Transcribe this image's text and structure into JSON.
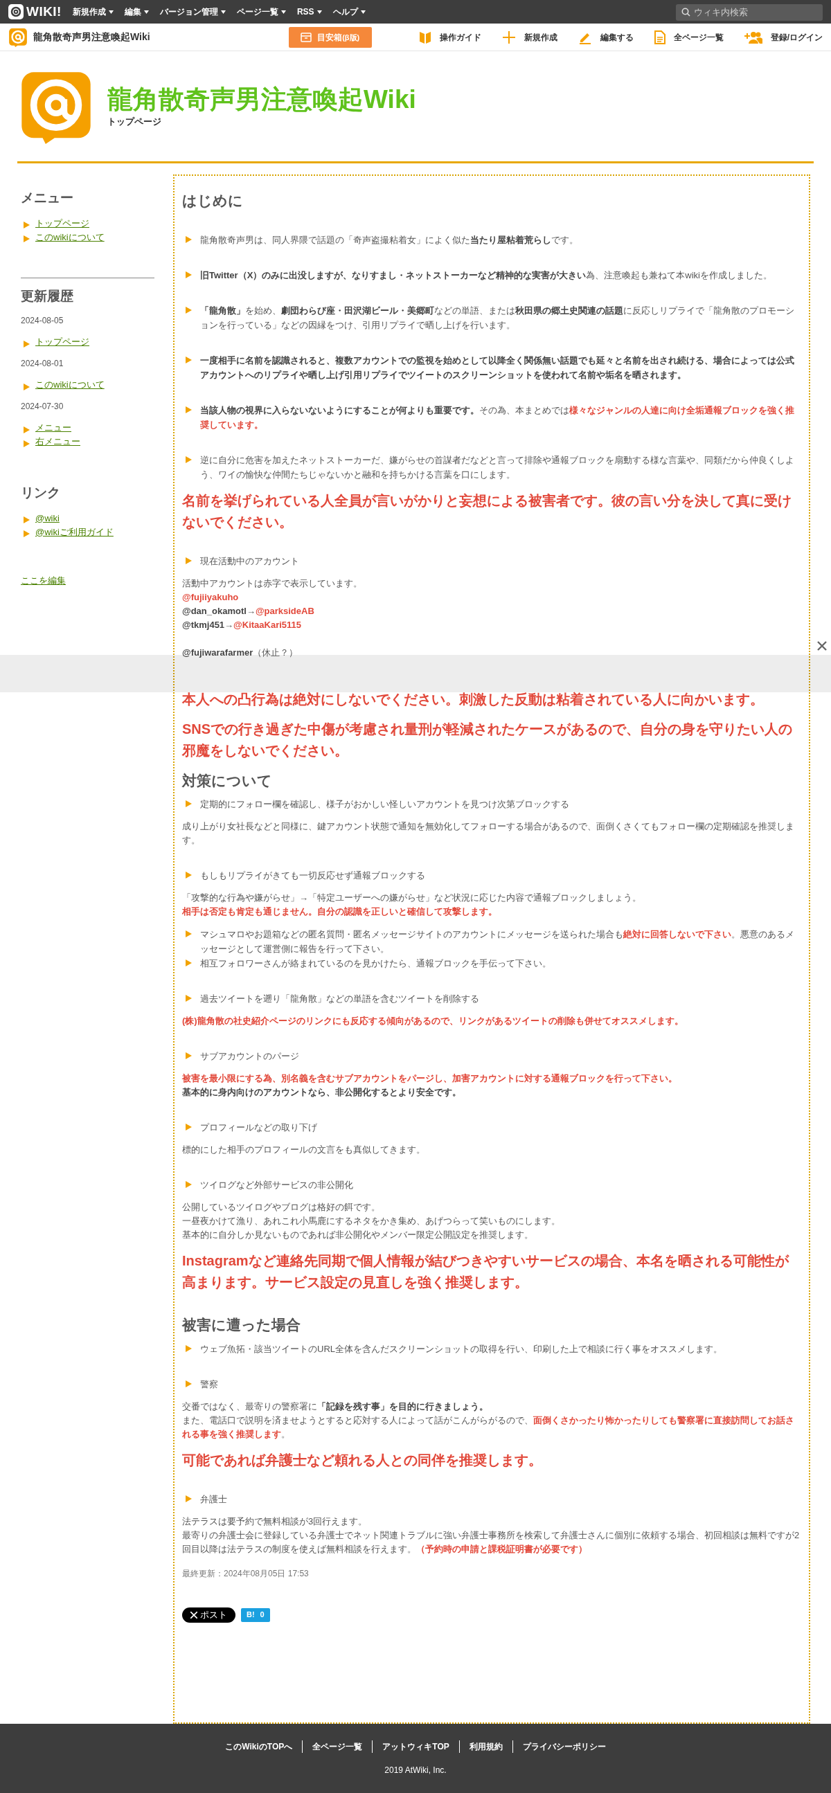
{
  "topbar": {
    "logo": "WIKI!",
    "menus": [
      {
        "label": "新規作成"
      },
      {
        "label": "編集"
      },
      {
        "label": "バージョン管理"
      },
      {
        "label": "ページ一覧"
      },
      {
        "label": "RSS"
      },
      {
        "label": "ヘルプ"
      }
    ],
    "search": {
      "placeholder": "ウィキ内検索"
    }
  },
  "sitebar": {
    "site_name": "龍角散奇声男注意喚起Wiki",
    "box_button": {
      "label": "目安箱",
      "suffix": "(β版)"
    },
    "links": [
      {
        "kind": "guide",
        "label": "操作ガイド"
      },
      {
        "kind": "new",
        "label": "新規作成"
      },
      {
        "kind": "edit",
        "label": "編集する"
      },
      {
        "kind": "pages",
        "label": "全ページ一覧"
      },
      {
        "kind": "login",
        "label": "登録/ログイン"
      }
    ]
  },
  "header": {
    "title": "龍角散奇声男注意喚起Wiki",
    "subtitle": "トップページ"
  },
  "sidebar": {
    "sections": [
      {
        "title": "メニュー",
        "entries": [
          {
            "kind": "link",
            "text": "トップページ"
          },
          {
            "kind": "link",
            "text": "このwikiについて"
          }
        ]
      },
      {
        "title": "更新履歴",
        "entries": [
          {
            "kind": "date",
            "text": "2024-08-05"
          },
          {
            "kind": "link",
            "text": "トップページ"
          },
          {
            "kind": "date",
            "text": "2024-08-01"
          },
          {
            "kind": "link",
            "text": "このwikiについて"
          },
          {
            "kind": "date",
            "text": "2024-07-30"
          },
          {
            "kind": "link",
            "text": "メニュー"
          },
          {
            "kind": "link",
            "text": "右メニュー"
          }
        ]
      },
      {
        "title": "リンク",
        "entries": [
          {
            "kind": "link",
            "text": "@wiki"
          },
          {
            "kind": "link",
            "text": "@wikiご利用ガイド"
          }
        ]
      }
    ],
    "edit_link": "ここを編集"
  },
  "content": {
    "groups": [
      {
        "blocks": [
          {
            "kind": "heading",
            "text": "はじめに"
          }
        ]
      },
      {
        "blocks": [
          {
            "kind": "bullet",
            "parts": [
              {
                "kind": "plain",
                "text": "龍角散奇声男は、同人界隈で話題の「奇声盗撮粘着女」によく似た"
              },
              {
                "kind": "bold",
                "text": "当たり屋粘着荒らし"
              },
              {
                "kind": "plain",
                "text": "です。"
              }
            ]
          }
        ]
      },
      {
        "blocks": [
          {
            "kind": "bullet",
            "parts": [
              {
                "kind": "bold",
                "text": "旧Twitter（X）のみに出没しますが、なりすまし・ネットストーカーなど精神的な実害が大きい"
              },
              {
                "kind": "plain",
                "text": "為、注意喚起も兼ねて本wikiを作成しました。"
              }
            ]
          }
        ]
      },
      {
        "blocks": [
          {
            "kind": "bullet",
            "parts": [
              {
                "kind": "bold",
                "text": "「龍角散」"
              },
              {
                "kind": "plain",
                "text": "を始め、"
              },
              {
                "kind": "bold",
                "text": "劇団わらび座・田沢湖ビール・美郷町"
              },
              {
                "kind": "plain",
                "text": "などの単語、または"
              },
              {
                "kind": "bold",
                "text": "秋田県の郷土史関連の話題"
              },
              {
                "kind": "plain",
                "text": "に反応しリプライで「龍角散のプロモーションを行っている」などの因縁をつけ、引用リプライで晒し上げを行います。"
              }
            ]
          }
        ]
      },
      {
        "blocks": [
          {
            "kind": "bullet",
            "parts": [
              {
                "kind": "bold",
                "text": "一度相手に名前を認識されると、複数アカウントでの監視を始めとして以降全く関係無い話題でも延々と名前を出され続ける、場合によっては公式アカウントへのリプライや晒し上げ引用リプライでツイートのスクリーンショットを使われて名前や垢名を晒されます。"
              }
            ]
          }
        ]
      },
      {
        "blocks": [
          {
            "kind": "bullet",
            "parts": [
              {
                "kind": "bold",
                "text": "当該人物の視界に入らないないようにすることが何よりも重要です。"
              },
              {
                "kind": "plain",
                "text": "その為、本まとめでは"
              },
              {
                "kind": "red",
                "text": "様々なジャンルの人達に向け全垢通報ブロックを強く推奨しています。"
              }
            ]
          }
        ]
      },
      {
        "blocks": [
          {
            "kind": "bullet",
            "parts": [
              {
                "kind": "plain",
                "text": "逆に自分に危害を加えたネットストーカーだ、嫌がらせの首謀者だなどと言って排除や通報ブロックを扇動する様な言葉や、同類だから仲良くしよう、ワイの愉快な仲間たちじゃないかと融和を持ちかける言葉を口にします。"
              }
            ]
          },
          {
            "kind": "alert",
            "text": "名前を挙げられている人全員が言いがかりと妄想による被害者です。彼の言い分を決して真に受けないでください。"
          }
        ]
      },
      {
        "blocks": [
          {
            "kind": "bullet",
            "parts": [
              {
                "kind": "plain",
                "text": "現在活動中のアカウント"
              }
            ]
          },
          {
            "kind": "text",
            "lines": [
              [
                {
                  "kind": "plain",
                  "text": "活動中アカウントは赤字で表示しています。"
                }
              ],
              [
                {
                  "kind": "red",
                  "text": "@fujiiyakuho"
                }
              ],
              [
                {
                  "kind": "bold",
                  "text": "@dan_okamotl"
                },
                {
                  "kind": "plain",
                  "text": "→"
                },
                {
                  "kind": "red",
                  "text": "@parksideAB"
                }
              ],
              [
                {
                  "kind": "bold",
                  "text": "@tkmj451"
                },
                {
                  "kind": "plain",
                  "text": "→"
                },
                {
                  "kind": "red",
                  "text": "@KitaaKari5115"
                }
              ]
            ]
          },
          {
            "kind": "text",
            "lines": [
              [
                {
                  "kind": "bold",
                  "text": "@fujiwarafarmer"
                },
                {
                  "kind": "plain",
                  "text": "（休止？）"
                }
              ]
            ]
          }
        ]
      },
      {
        "blocks": [
          {
            "kind": "alert",
            "text": "本人への凸行為は絶対にしないでください。刺激した反動は粘着されている人に向かいます。"
          },
          {
            "kind": "alert",
            "text": "SNSでの行き過ぎた中傷が考慮され量刑が軽減されたケースがあるので、自分の身を守りたい人の邪魔をしないでください。"
          },
          {
            "kind": "heading",
            "text": "対策について"
          },
          {
            "kind": "bullet",
            "parts": [
              {
                "kind": "plain",
                "text": "定期的にフォロー欄を確認し、様子がおかしい怪しいアカウントを見つけ次第ブロックする"
              }
            ]
          },
          {
            "kind": "text",
            "lines": [
              [
                {
                  "kind": "plain",
                  "text": "成り上がり女社長などと同様に、鍵アカウント状態で通知を無効化してフォローする場合があるので、面倒くさくてもフォロー欄の定期確認を推奨します。"
                }
              ]
            ]
          }
        ]
      },
      {
        "blocks": [
          {
            "kind": "bullet",
            "parts": [
              {
                "kind": "plain",
                "text": "もしもリプライがきても一切反応せず通報ブロックする"
              }
            ]
          },
          {
            "kind": "text",
            "lines": [
              [
                {
                  "kind": "plain",
                  "text": "「攻撃的な行為や嫌がらせ」→「特定ユーザーへの嫌がらせ」など状況に応じた内容で通報ブロックしましょう。"
                }
              ],
              [
                {
                  "kind": "red",
                  "text": "相手は否定も肯定も通じません。自分の認識を正しいと確信して攻撃します。"
                }
              ]
            ]
          },
          {
            "kind": "bullet",
            "parts": [
              {
                "kind": "plain",
                "text": "マシュマロやお題箱などの匿名質問・匿名メッセージサイトのアカウントにメッセージを送られた場合も"
              },
              {
                "kind": "red",
                "text": "絶対に回答しないで下さい"
              },
              {
                "kind": "plain",
                "text": "。悪意のあるメッセージとして運営側に報告を行って下さい。"
              }
            ]
          },
          {
            "kind": "bullet",
            "parts": [
              {
                "kind": "plain",
                "text": "相互フォロワーさんが絡まれているのを見かけたら、通報ブロックを手伝って下さい。"
              }
            ]
          }
        ]
      },
      {
        "blocks": [
          {
            "kind": "bullet",
            "parts": [
              {
                "kind": "plain",
                "text": "過去ツイートを遡り「龍角散」などの単語を含むツイートを削除する"
              }
            ]
          },
          {
            "kind": "text",
            "lines": [
              [
                {
                  "kind": "red",
                  "text": "(株)龍角散の社史紹介ページのリンクにも反応する傾向があるので、リンクがあるツイートの削除も併せてオススメします。"
                }
              ]
            ]
          }
        ]
      },
      {
        "blocks": [
          {
            "kind": "bullet",
            "parts": [
              {
                "kind": "plain",
                "text": "サブアカウントのパージ"
              }
            ]
          },
          {
            "kind": "text",
            "lines": [
              [
                {
                  "kind": "red",
                  "text": "被害を最小限にする為、別名義を含むサブアカウントをパージし、加害アカウントに対する通報ブロックを行って下さい。"
                }
              ],
              [
                {
                  "kind": "bold",
                  "text": "基本的に身内向けのアカウントなら、非公開化するとより安全です。"
                }
              ]
            ]
          }
        ]
      },
      {
        "blocks": [
          {
            "kind": "bullet",
            "parts": [
              {
                "kind": "plain",
                "text": "プロフィールなどの取り下げ"
              }
            ]
          },
          {
            "kind": "text",
            "lines": [
              [
                {
                  "kind": "plain",
                  "text": "標的にした相手のプロフィールの文言をも真似してきます。"
                }
              ]
            ]
          }
        ]
      },
      {
        "blocks": [
          {
            "kind": "bullet",
            "parts": [
              {
                "kind": "plain",
                "text": "ツイログなど外部サービスの非公開化"
              }
            ]
          },
          {
            "kind": "text",
            "lines": [
              [
                {
                  "kind": "plain",
                  "text": "公開しているツイログやブログは格好の餌です。"
                }
              ],
              [
                {
                  "kind": "plain",
                  "text": "一昼夜かけて漁り、あれこれ小馬鹿にするネタをかき集め、あげつらって笑いものにします。"
                }
              ],
              [
                {
                  "kind": "plain",
                  "text": "基本的に自分しか見ないものであれば非公開化やメンバー限定公開設定を推奨します。"
                }
              ]
            ]
          },
          {
            "kind": "alert",
            "text": "Instagramなど連絡先同期で個人情報が結びつきやすいサービスの場合、本名を晒される可能性が高まります。サービス設定の見直しを強く推奨します。"
          }
        ]
      },
      {
        "blocks": [
          {
            "kind": "heading",
            "text": "被害に遭った場合"
          },
          {
            "kind": "bullet",
            "parts": [
              {
                "kind": "plain",
                "text": "ウェブ魚拓・該当ツイートのURL全体を含んだスクリーンショットの取得を行い、印刷した上で相談に行く事をオススメします。"
              }
            ]
          }
        ]
      },
      {
        "blocks": [
          {
            "kind": "bullet",
            "parts": [
              {
                "kind": "plain",
                "text": "警察"
              }
            ]
          },
          {
            "kind": "text",
            "lines": [
              [
                {
                  "kind": "plain",
                  "text": "交番ではなく、最寄りの警察署に"
                },
                {
                  "kind": "bold",
                  "text": "「記録を残す事」を目的に行きましょう。"
                }
              ],
              [
                {
                  "kind": "plain",
                  "text": "また、電話口で説明を済ませようとすると応対する人によって話がこんがらがるので、"
                },
                {
                  "kind": "red",
                  "text": "面倒くさかったり怖かったりしても警察署に直接訪問してお話される事を強く推奨します"
                },
                {
                  "kind": "plain",
                  "text": "。"
                }
              ]
            ]
          },
          {
            "kind": "alert",
            "text": "可能であれば弁護士など頼れる人との同伴を推奨します。"
          }
        ]
      },
      {
        "blocks": [
          {
            "kind": "bullet",
            "parts": [
              {
                "kind": "plain",
                "text": "弁護士"
              }
            ]
          },
          {
            "kind": "text",
            "lines": [
              [
                {
                  "kind": "plain",
                  "text": "法テラスは要予約で無料相談が3回行えます。"
                }
              ],
              [
                {
                  "kind": "plain",
                  "text": "最寄りの弁護士会に登録している弁護士でネット関連トラブルに強い弁護士事務所を検索して弁護士さんに個別に依頼する場合、初回相談は無料ですが2回目以降は法テラスの制度を使えば無料相談を行えます。"
                },
                {
                  "kind": "red",
                  "text": "（予約時の申請と課税証明書が必要です）"
                }
              ]
            ]
          },
          {
            "kind": "updated",
            "text": "最終更新：2024年08月05日 17:53"
          }
        ]
      }
    ],
    "share": {
      "post_label": "ポスト",
      "hatena_label": "B!",
      "hatena_count": "0"
    }
  },
  "footer": {
    "links": [
      "このWikiのTOPへ",
      "全ページ一覧",
      "アットウィキTOP",
      "利用規約",
      "プライバシーポリシー"
    ],
    "copyright": "2019 AtWiki, Inc."
  }
}
